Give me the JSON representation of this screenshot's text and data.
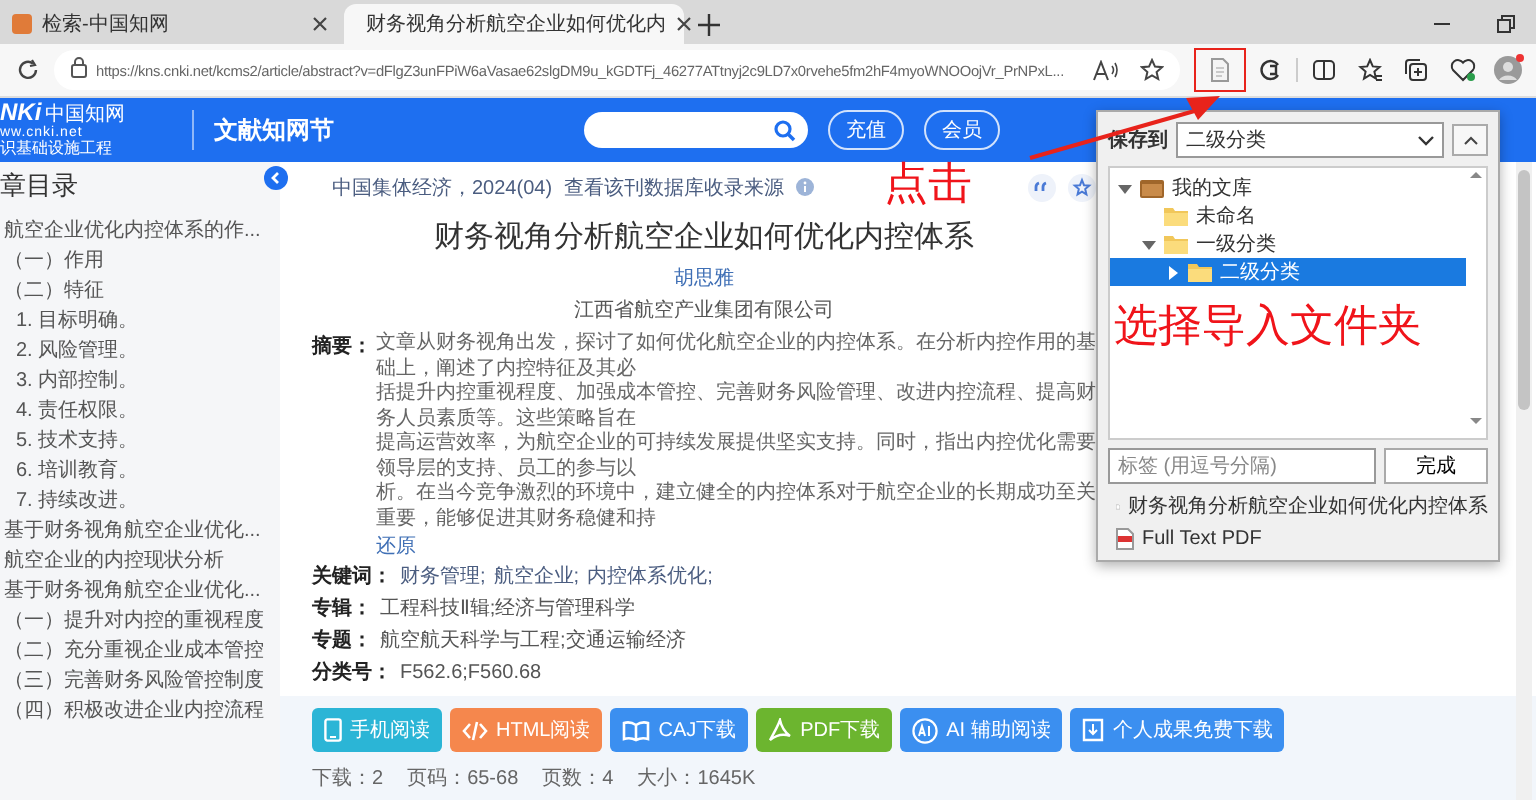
{
  "tabs": [
    {
      "title": "检索-中国知网",
      "selected": false
    },
    {
      "title": "财务视角分析航空企业如何优化内",
      "selected": true
    }
  ],
  "address_bar": {
    "url": "https://kns.cnki.net/kcms2/article/abstract?v=dFlgZ3unFPiW6aVasae62slgDM9u_kGDTFj_46277ATtnyj2c9LD7x0rvehe5fm2hF4myoWNOOojVr_PrNPxL..."
  },
  "toolbar": [
    {
      "kind": "page",
      "highlighted": true
    },
    {
      "kind": "copilot",
      "highlighted": false
    },
    {
      "kind": "split",
      "highlighted": false
    },
    {
      "kind": "favorites",
      "highlighted": false
    },
    {
      "kind": "collections",
      "highlighted": false
    },
    {
      "kind": "essentials",
      "highlighted": false
    },
    {
      "kind": "profile",
      "highlighted": false
    }
  ],
  "site_header": {
    "logo_mark": "NKi",
    "logo_name": "中国知网",
    "logo_url": "ww.cnki.net",
    "logo_tagline": "识基础设施工程",
    "section": "文献知网节",
    "buttons": [
      "充值",
      "会员"
    ]
  },
  "toc": {
    "heading": "章目录",
    "items": [
      {
        "label": "航空企业优化内控体系的作..."
      },
      {
        "label": "（一）作用"
      },
      {
        "label": "（二）特征",
        "children": [
          {
            "label": "1. 目标明确。"
          },
          {
            "label": "2. 风险管理。"
          },
          {
            "label": "3. 内部控制。"
          },
          {
            "label": "4. 责任权限。"
          },
          {
            "label": "5. 技术支持。"
          },
          {
            "label": "6. 培训教育。"
          },
          {
            "label": "7. 持续改进。"
          }
        ]
      },
      {
        "label": "基于财务视角航空企业优化..."
      },
      {
        "label": "航空企业的内控现状分析"
      },
      {
        "label": "基于财务视角航空企业优化..."
      },
      {
        "label": "（一）提升对内控的重视程度"
      },
      {
        "label": "（二）充分重视企业成本管控"
      },
      {
        "label": "（三）完善财务风险管控制度"
      },
      {
        "label": "（四）积极改进企业内控流程"
      }
    ]
  },
  "article": {
    "source": "中国集体经济，2024(04)",
    "source_link": "查看该刊数据库收录来源",
    "title": "财务视角分析航空企业如何优化内控体系",
    "author": "胡思雅",
    "organization": "江西省航空产业集团有限公司",
    "abstract_label": "摘要：",
    "abstract_lines": [
      "文章从财务视角出发，探讨了如何优化航空企业的内控体系。在分析内控作用的基础上，阐述了内控特征及其必",
      "括提升内控重视程度、加强成本管控、完善财务风险管理、改进内控流程、提高财务人员素质等。这些策略旨在",
      "提高运营效率，为航空企业的可持续发展提供坚实支持。同时，指出内控优化需要领导层的支持、员工的参与以",
      "析。在当今竞争激烈的环境中，建立健全的内控体系对于航空企业的长期成功至关重要，能够促进其财务稳健和持"
    ],
    "restore_link": "还原",
    "keywords_label": "关键词：",
    "keywords": [
      "财务管理;",
      "航空企业;",
      "内控体系优化;"
    ],
    "fields": [
      {
        "label": "专辑：",
        "value": "工程科技Ⅱ辑;经济与管理科学"
      },
      {
        "label": "专题：",
        "value": "航空航天科学与工程;交通运输经济"
      },
      {
        "label": "分类号：",
        "value": "F562.6;F560.68"
      }
    ],
    "actions": [
      {
        "kind": "phone",
        "label": "手机阅读",
        "color": "#2bb5d6"
      },
      {
        "kind": "html",
        "label": "HTML阅读",
        "color": "#f5874d"
      },
      {
        "kind": "book",
        "label": "CAJ下载",
        "color": "#3b8ff0"
      },
      {
        "kind": "pdf",
        "label": "PDF下载",
        "color": "#6cb52f"
      },
      {
        "kind": "ai",
        "label": "AI 辅助阅读",
        "color": "#3b8ff0"
      },
      {
        "kind": "personal",
        "label": "个人成果免费下载",
        "color": "#3b8ff0"
      }
    ],
    "stats": [
      "下载：2",
      "页码：65-68",
      "页数：4",
      "大小：1645K"
    ]
  },
  "save_popup": {
    "label": "保存到",
    "folder_select": "二级分类",
    "tree": [
      {
        "label": "我的文库",
        "kind": "library",
        "expanded": true,
        "selected": false,
        "children": [
          {
            "label": "未命名",
            "kind": "folder",
            "selected": false
          },
          {
            "label": "一级分类",
            "kind": "folder",
            "expanded": true,
            "selected": false,
            "children": [
              {
                "label": "二级分类",
                "kind": "folder",
                "expanded": false,
                "selected": true
              }
            ]
          }
        ]
      }
    ],
    "tags_placeholder": "标签 (用逗号分隔)",
    "done_button": "完成",
    "items": [
      {
        "kind": "document",
        "label": "财务视角分析航空企业如何优化内控体系"
      },
      {
        "kind": "pdf",
        "label": "Full Text PDF"
      }
    ]
  },
  "annotations": [
    {
      "text": "点击"
    },
    {
      "text": "选择导入文件夹"
    }
  ]
}
